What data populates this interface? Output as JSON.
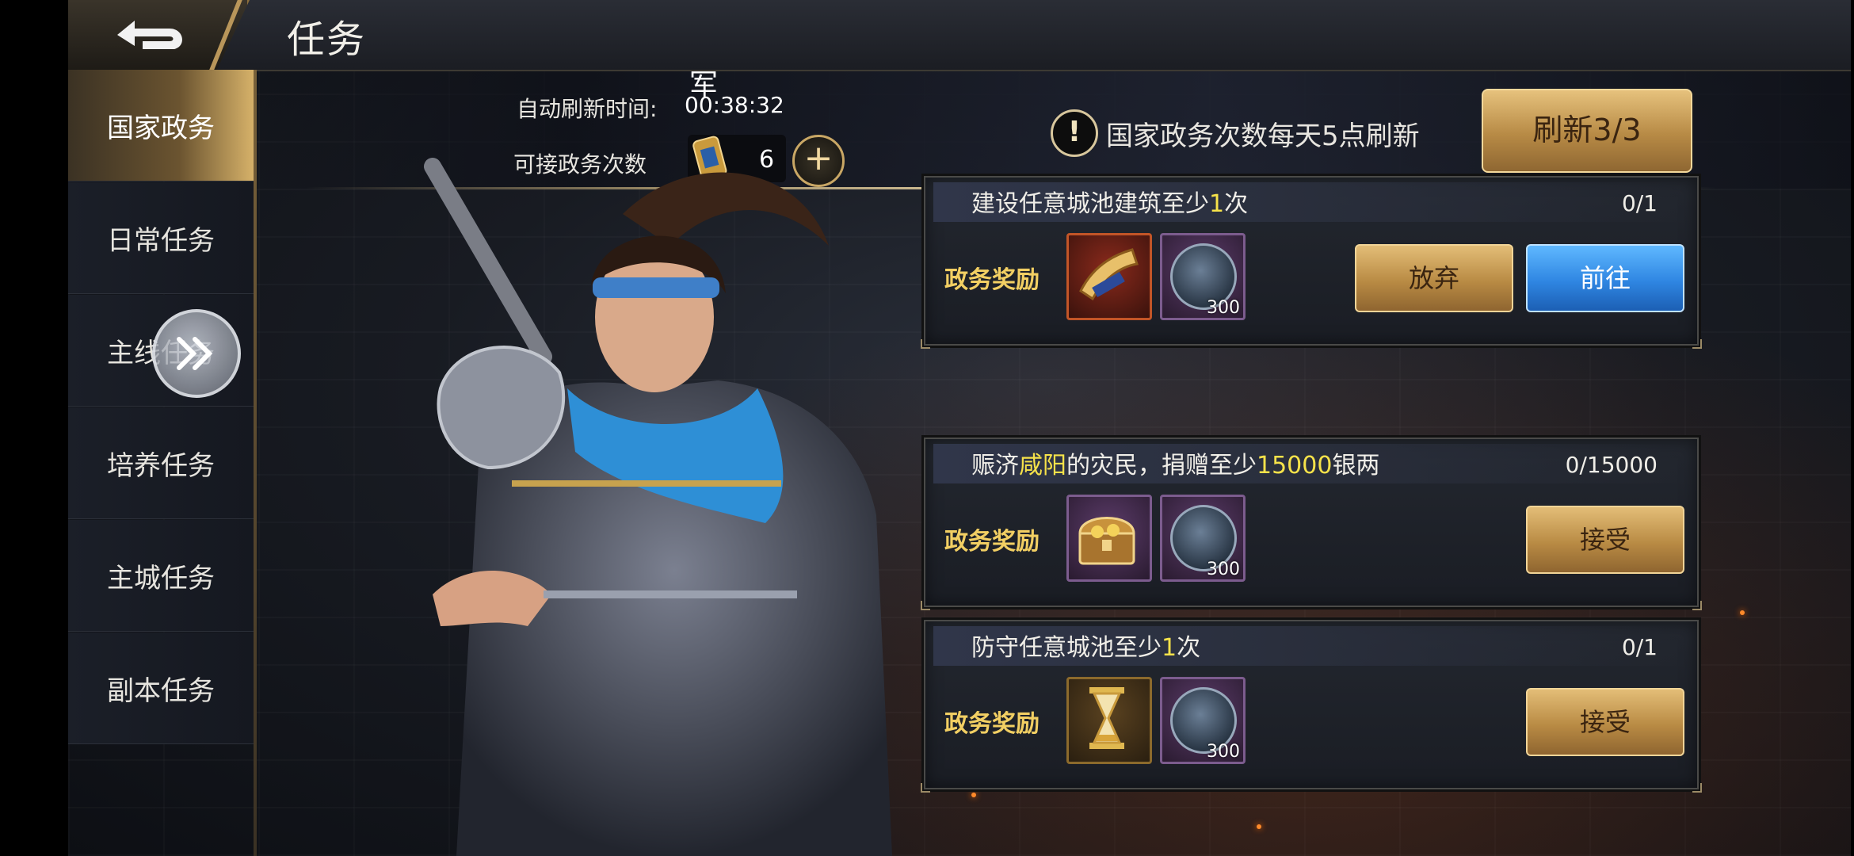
{
  "header": {
    "title": "任务"
  },
  "sidebar": {
    "tabs": [
      {
        "label": "国家政务",
        "active": true
      },
      {
        "label": "日常任务",
        "active": false
      },
      {
        "label": "主线任务",
        "active": false
      },
      {
        "label": "培养任务",
        "active": false
      },
      {
        "label": "主城任务",
        "active": false
      },
      {
        "label": "副本任务",
        "active": false
      }
    ]
  },
  "info": {
    "army_label": "军",
    "refresh_label": "自动刷新时间:",
    "refresh_time": "00:38:32",
    "count_label": "可接政务次数",
    "count_value": "6",
    "plus_symbol": "+",
    "notice_symbol": "!",
    "notice_text": "国家政务次数每天5点刷新",
    "refresh_button": "刷新3/3"
  },
  "quests": [
    {
      "title_parts": [
        "建设任意城池建筑至少",
        "1",
        "次"
      ],
      "progress": "0/1",
      "reward_label": "政务奖励",
      "items": [
        {
          "icon": "war-horn-icon",
          "qty": ""
        },
        {
          "icon": "silver-coin-icon",
          "qty": "300"
        }
      ],
      "buttons": [
        "放弃",
        "前往"
      ]
    },
    {
      "title_parts": [
        "赈济",
        "咸阳",
        "的灾民，捐赠至少",
        "15000",
        "银两"
      ],
      "progress": "0/15000",
      "reward_label": "政务奖励",
      "items": [
        {
          "icon": "treasure-chest-icon",
          "qty": ""
        },
        {
          "icon": "silver-coin-icon",
          "qty": "300"
        }
      ],
      "buttons": [
        "接受"
      ]
    },
    {
      "title_parts": [
        "防守任意城池至少",
        "1",
        "次"
      ],
      "progress": "0/1",
      "reward_label": "政务奖励",
      "items": [
        {
          "icon": "hourglass-icon",
          "qty": ""
        },
        {
          "icon": "silver-coin-icon",
          "qty": "300"
        }
      ],
      "buttons": [
        "接受"
      ]
    }
  ],
  "colors": {
    "highlight": "#f6e24a",
    "reward_label": "#f2cf63",
    "gold_button": "#b98b44",
    "blue_button": "#2f86e2"
  }
}
